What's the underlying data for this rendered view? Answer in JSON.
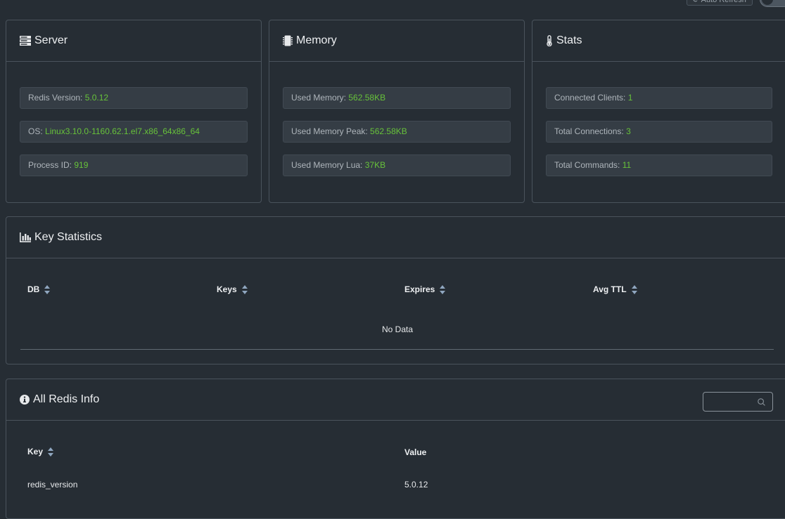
{
  "top": {
    "auto_refresh_label": "⟳ Auto Refresh"
  },
  "server": {
    "title": "Server",
    "version_label": "Redis Version: ",
    "version_value": "5.0.12",
    "os_label": "OS: ",
    "os_value": "Linux3.10.0-1160.62.1.el7.x86_64x86_64",
    "pid_label": "Process ID: ",
    "pid_value": "919"
  },
  "memory": {
    "title": "Memory",
    "used_label": "Used Memory: ",
    "used_value": "562.58KB",
    "peak_label": "Used Memory Peak: ",
    "peak_value": "562.58KB",
    "lua_label": "Used Memory Lua: ",
    "lua_value": "37KB"
  },
  "stats": {
    "title": "Stats",
    "clients_label": "Connected Clients: ",
    "clients_value": "1",
    "connections_label": "Total Connections: ",
    "connections_value": "3",
    "commands_label": "Total Commands: ",
    "commands_value": "11"
  },
  "key_statistics": {
    "title": "Key Statistics",
    "columns": [
      "DB",
      "Keys",
      "Expires",
      "Avg TTL"
    ],
    "empty_text": "No Data"
  },
  "all_info": {
    "title": "All Redis Info",
    "search_placeholder": "",
    "columns": [
      "Key",
      "Value"
    ],
    "rows": [
      {
        "key": "redis_version",
        "value": "5.0.12"
      }
    ]
  },
  "colors": {
    "accent_value": "#67c23a",
    "background": "#262d34",
    "border": "#4a535c"
  }
}
